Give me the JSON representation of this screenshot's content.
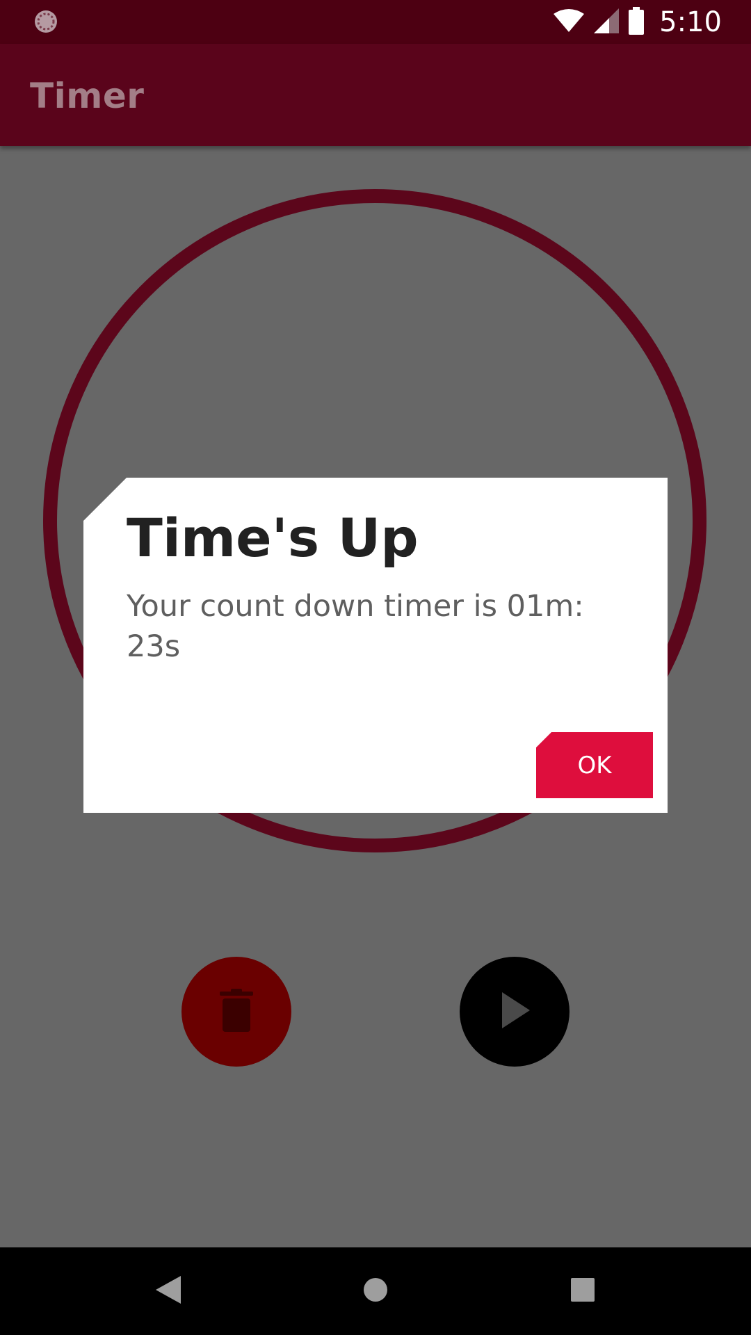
{
  "status_bar": {
    "time": "5:10",
    "icons": [
      "loading-spinner-icon",
      "wifi-icon",
      "cellular-signal-icon",
      "battery-icon"
    ]
  },
  "app_bar": {
    "title": "Timer"
  },
  "timer": {
    "ring_color": "#5c061b"
  },
  "controls": {
    "delete_icon": "trash-icon",
    "play_icon": "play-icon",
    "delete_color": "#6a0000",
    "play_color": "#000000"
  },
  "dialog": {
    "title": "Time's Up",
    "message": "Your count down timer is 01m: 23s",
    "ok_label": "OK",
    "accent_color": "#de0e3d"
  },
  "nav_bar": {
    "icons": [
      "back-icon",
      "home-icon",
      "recents-icon"
    ]
  }
}
